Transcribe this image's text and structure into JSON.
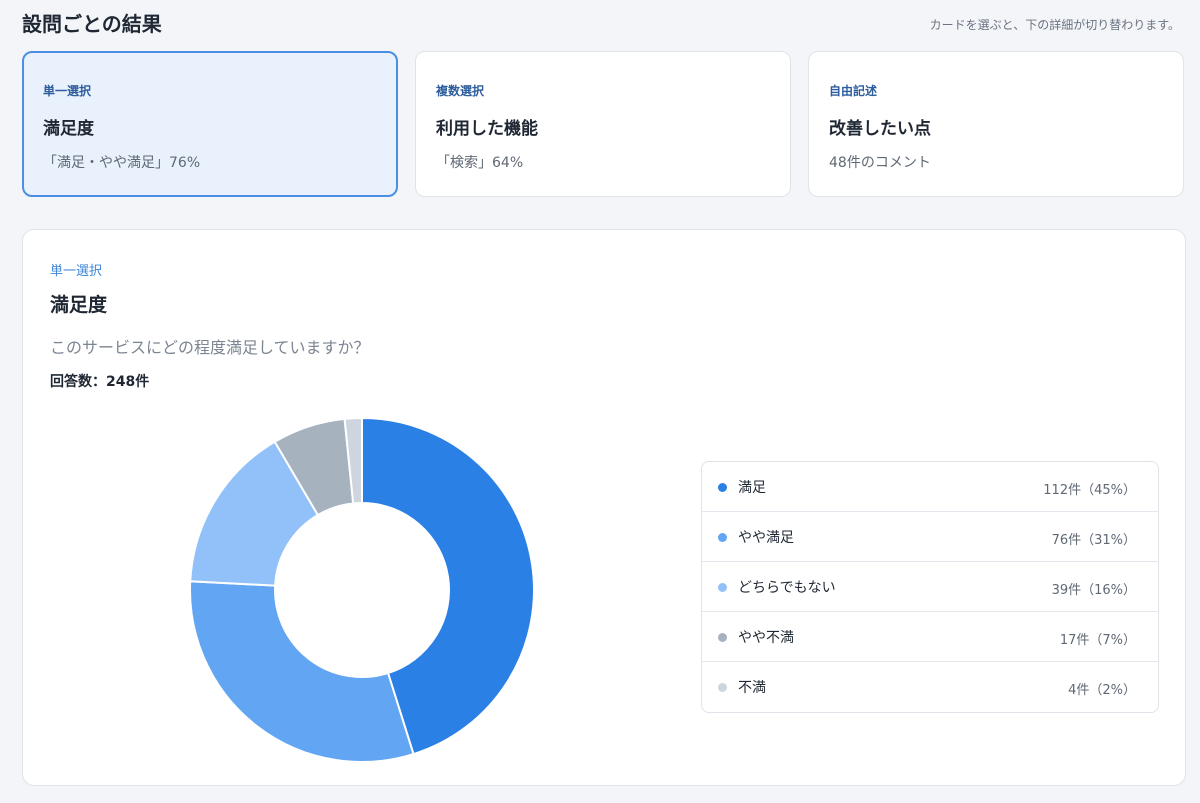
{
  "header": {
    "title": "設問ごとの結果",
    "hint": "カードを選ぶと、下の詳細が切り替わります。"
  },
  "cards": [
    {
      "type": "単一選択",
      "title": "満足度",
      "summary": "「満足・やや満足」76%",
      "selected": true
    },
    {
      "type": "複数選択",
      "title": "利用した機能",
      "summary": "「検索」64%",
      "selected": false
    },
    {
      "type": "自由記述",
      "title": "改善したい点",
      "summary": "48件のコメント",
      "selected": false
    }
  ],
  "detail": {
    "type": "単一選択",
    "title": "満足度",
    "question": "このサービスにどの程度満足していますか？",
    "response_count": "回答数：248件"
  },
  "chart_data": {
    "type": "pie",
    "donut": true,
    "categories": [
      "満足",
      "やや満足",
      "どちらでもない",
      "やや不満",
      "不満"
    ],
    "values": [
      112,
      76,
      39,
      17,
      4
    ],
    "colors": [
      "#2b80e6",
      "#62a5f2",
      "#91c1f8",
      "#a7b2bf",
      "#ced5de"
    ],
    "value_labels": [
      "112件（45%）",
      "76件（31%）",
      "39件（16%）",
      "17件（7%）",
      "4件（2%）"
    ],
    "legend_position": "right"
  }
}
